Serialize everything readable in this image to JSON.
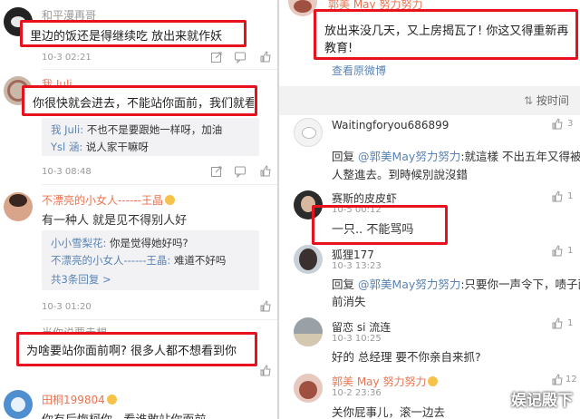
{
  "left": {
    "top_username": "和平漫再哥",
    "highlight1": "里边的饭还是得继续吃 放出来就作妖",
    "meta1": "10-3 02:21",
    "user2": "我 Juli",
    "highlight2": "你很快就会进去，不能站你面前，我们就看",
    "reply2": [
      {
        "who": "我 Juli:",
        "text": " 不也不是要跟她一样呀，加油"
      },
      {
        "who": "Ysl 涵:",
        "text": " 说人家干嘛呀"
      }
    ],
    "meta2": "10-3 08:48",
    "user3": "不漂亮的小女人------王晶",
    "text3": "有一种人 就是见不得别人好",
    "reply3": [
      {
        "who": "小小雪梨花:",
        "text": " 你是觉得她好吗?"
      },
      {
        "who": "不漂亮的小女人------王晶:",
        "text": " 难道不好吗"
      }
    ],
    "more3": "共3条回复 >",
    "meta3": "10-3 01:20",
    "user4": "当你说要走想",
    "highlight4": "为啥要站你面前啊? 很多人都不想看到你",
    "user5": "田桐199804",
    "text5": "你有后悔柯你 . 看谁敢站你面前",
    "user1_count": ""
  },
  "right": {
    "top_username": "郭美 May 努力努力",
    "highlight_post": [
      "放出来没几天，又上房揭瓦了! 你这又得重新再",
      "教育!"
    ],
    "view_original": "查看原微博",
    "sort_label": "按时间",
    "c1_user": "Waitingforyou686899",
    "c1_text": [
      "回复 @郭美May努力努力:就這樣 不出五年又得被",
      "人整進去。到時候別說沒錯"
    ],
    "c1_mention": "@郭美May努力努力",
    "c1_like": "3",
    "c2_user": "赛斯的皮皮虾",
    "c2_meta": "10-5 00:12",
    "c2_text": "一只.. 不能骂吗",
    "c2_like": "1",
    "c3_user": "狐狸177",
    "c3_meta": "10-3 13:23",
    "c3_text": [
      "回复 @郭美May努力努力:只要你一声令下，啧子面",
      "前消失"
    ],
    "c3_like": "1",
    "c4_user": "留恋 si 流连",
    "c4_meta": "10-3 10:25",
    "c4_text": "好的 总经理 要不你亲自来抓?",
    "c4_like": "1",
    "c5_user": "郭美 May 努力努力",
    "c5_meta": "10-2 23:36",
    "c5_text": "关你屁事儿，滚一边去",
    "c5_like": "12"
  },
  "watermark": "娱记殿下",
  "colors": {
    "highlight_border": "#e8121f",
    "link": "#5a84b4",
    "accent_name": "#eb7350"
  }
}
